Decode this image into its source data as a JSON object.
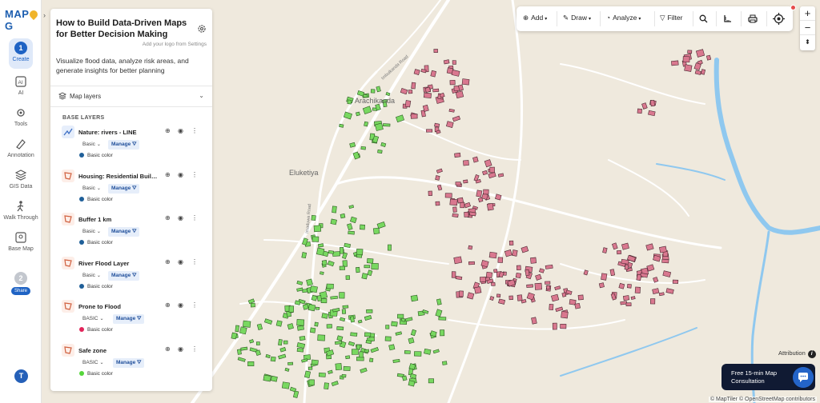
{
  "app": {
    "logo_left": "MAP",
    "logo_right": "G"
  },
  "rail": {
    "steps": [
      {
        "num": "1",
        "label": "Create"
      },
      {
        "num": "2",
        "label": "Share"
      }
    ],
    "items": [
      {
        "label": "AI"
      },
      {
        "label": "Tools"
      },
      {
        "label": "Annotation"
      },
      {
        "label": "GIS Data"
      },
      {
        "label": "Walk Through"
      },
      {
        "label": "Base Map"
      }
    ],
    "avatar_initial": "T"
  },
  "panel": {
    "title": "How to Build Data-Driven Maps for Better Decision Making",
    "logo_hint": "Add your logo from Settings",
    "description": "Visualize flood data, analyze risk areas, and generate insights for better planning",
    "map_layers_label": "Map layers",
    "base_layers_label": "BASE LAYERS",
    "layers": [
      {
        "name": "Nature: rivers - LINE",
        "type": "Basic",
        "manage": "Manage",
        "color_label": "Basic color",
        "color": "#1f5f99"
      },
      {
        "name": "Housing: Residential Buildings",
        "type": "Basic",
        "manage": "Manage",
        "color_label": "Basic color",
        "color": "#1f5f99"
      },
      {
        "name": "Buffer 1 km",
        "type": "Basic",
        "manage": "Manage",
        "color_label": "Basic color",
        "color": "#1f5f99"
      },
      {
        "name": "River Flood Layer",
        "type": "Basic",
        "manage": "Manage",
        "color_label": "Basic color",
        "color": "#1f5f99"
      },
      {
        "name": "Prone to Flood",
        "type": "BASIC",
        "manage": "Manage",
        "color_label": "Basic color",
        "color": "#e2245a"
      },
      {
        "name": "Safe zone",
        "type": "BASIC",
        "manage": "Manage",
        "color_label": "Basic color",
        "color": "#55d63b"
      }
    ]
  },
  "toolbar": {
    "add_label": "Add",
    "draw_label": "Draw",
    "analyze_label": "Analyze",
    "filter_label": "Filter"
  },
  "map": {
    "place_labels": [
      "Arachikanda",
      "Eluketiya"
    ],
    "road_labels": [
      "Imbulkanda Road",
      "Imaduwa Road"
    ],
    "colors": {
      "flood_prone": "#d9788f",
      "safe": "#78d860",
      "water": "#8fc8ef",
      "land": "#efe9dd"
    }
  },
  "attribution": {
    "button_label": "Attribution",
    "text": "© MapTiler © OpenStreetMap contributors"
  },
  "consultation": {
    "line1": "Free 15-min Map",
    "line2": "Consultation"
  }
}
